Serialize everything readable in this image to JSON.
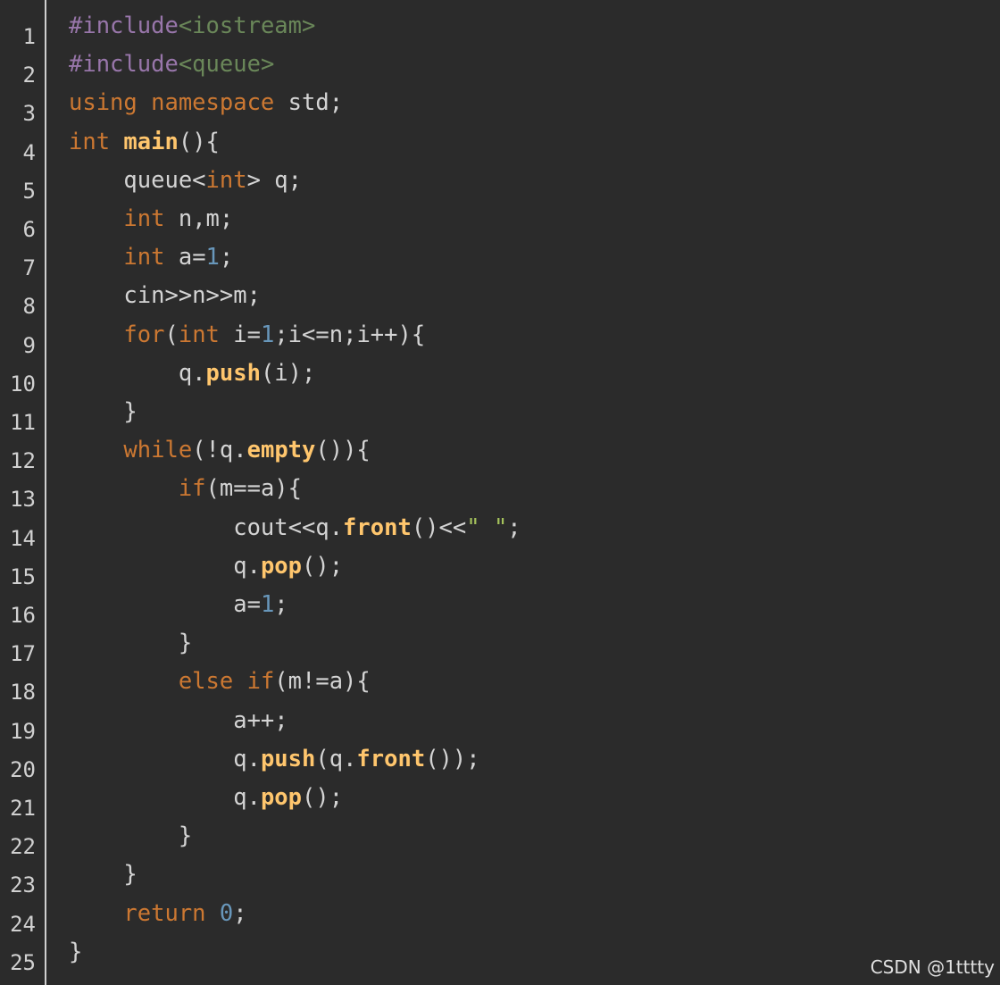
{
  "editor": {
    "lines": [
      {
        "no": "1",
        "tokens": [
          {
            "t": "#include",
            "c": "pp"
          },
          {
            "t": "<iostream>",
            "c": "inc"
          }
        ]
      },
      {
        "no": "2",
        "tokens": [
          {
            "t": "#include",
            "c": "pp"
          },
          {
            "t": "<queue>",
            "c": "inc"
          }
        ]
      },
      {
        "no": "3",
        "tokens": [
          {
            "t": "using namespace",
            "c": "kw"
          },
          {
            "t": " std;",
            "c": "plain"
          }
        ]
      },
      {
        "no": "4",
        "tokens": [
          {
            "t": "int",
            "c": "kw"
          },
          {
            "t": " ",
            "c": "plain"
          },
          {
            "t": "main",
            "c": "fn"
          },
          {
            "t": "(){",
            "c": "plain"
          }
        ]
      },
      {
        "no": "5",
        "tokens": [
          {
            "t": "    queue<",
            "c": "plain"
          },
          {
            "t": "int",
            "c": "kw"
          },
          {
            "t": "> q;",
            "c": "plain"
          }
        ]
      },
      {
        "no": "6",
        "tokens": [
          {
            "t": "    ",
            "c": "plain"
          },
          {
            "t": "int",
            "c": "kw"
          },
          {
            "t": " n,m;",
            "c": "plain"
          }
        ]
      },
      {
        "no": "7",
        "tokens": [
          {
            "t": "    ",
            "c": "plain"
          },
          {
            "t": "int",
            "c": "kw"
          },
          {
            "t": " a=",
            "c": "plain"
          },
          {
            "t": "1",
            "c": "num"
          },
          {
            "t": ";",
            "c": "plain"
          }
        ]
      },
      {
        "no": "8",
        "tokens": [
          {
            "t": "    cin>>n>>m;",
            "c": "plain"
          }
        ]
      },
      {
        "no": "9",
        "tokens": [
          {
            "t": "    ",
            "c": "plain"
          },
          {
            "t": "for",
            "c": "kw"
          },
          {
            "t": "(",
            "c": "plain"
          },
          {
            "t": "int",
            "c": "kw"
          },
          {
            "t": " i=",
            "c": "plain"
          },
          {
            "t": "1",
            "c": "num"
          },
          {
            "t": ";i<=n;i++){",
            "c": "plain"
          }
        ]
      },
      {
        "no": "10",
        "tokens": [
          {
            "t": "        q.",
            "c": "plain"
          },
          {
            "t": "push",
            "c": "fn"
          },
          {
            "t": "(i);",
            "c": "plain"
          }
        ]
      },
      {
        "no": "11",
        "tokens": [
          {
            "t": "    }",
            "c": "plain"
          }
        ]
      },
      {
        "no": "12",
        "tokens": [
          {
            "t": "    ",
            "c": "plain"
          },
          {
            "t": "while",
            "c": "kw"
          },
          {
            "t": "(!q.",
            "c": "plain"
          },
          {
            "t": "empty",
            "c": "fn"
          },
          {
            "t": "()){",
            "c": "plain"
          }
        ]
      },
      {
        "no": "13",
        "tokens": [
          {
            "t": "        ",
            "c": "plain"
          },
          {
            "t": "if",
            "c": "kw"
          },
          {
            "t": "(m==a){",
            "c": "plain"
          }
        ]
      },
      {
        "no": "14",
        "tokens": [
          {
            "t": "            cout<<q.",
            "c": "plain"
          },
          {
            "t": "front",
            "c": "fn"
          },
          {
            "t": "()<<",
            "c": "plain"
          },
          {
            "t": "\" \"",
            "c": "str"
          },
          {
            "t": ";",
            "c": "plain"
          }
        ]
      },
      {
        "no": "15",
        "tokens": [
          {
            "t": "            q.",
            "c": "plain"
          },
          {
            "t": "pop",
            "c": "fn"
          },
          {
            "t": "();",
            "c": "plain"
          }
        ]
      },
      {
        "no": "16",
        "tokens": [
          {
            "t": "            a=",
            "c": "plain"
          },
          {
            "t": "1",
            "c": "num"
          },
          {
            "t": ";",
            "c": "plain"
          }
        ]
      },
      {
        "no": "17",
        "tokens": [
          {
            "t": "        }",
            "c": "plain"
          }
        ]
      },
      {
        "no": "18",
        "tokens": [
          {
            "t": "        ",
            "c": "plain"
          },
          {
            "t": "else if",
            "c": "kw"
          },
          {
            "t": "(m!=a){",
            "c": "plain"
          }
        ]
      },
      {
        "no": "19",
        "tokens": [
          {
            "t": "            a++;",
            "c": "plain"
          }
        ]
      },
      {
        "no": "20",
        "tokens": [
          {
            "t": "            q.",
            "c": "plain"
          },
          {
            "t": "push",
            "c": "fn"
          },
          {
            "t": "(q.",
            "c": "plain"
          },
          {
            "t": "front",
            "c": "fn"
          },
          {
            "t": "());",
            "c": "plain"
          }
        ]
      },
      {
        "no": "21",
        "tokens": [
          {
            "t": "            q.",
            "c": "plain"
          },
          {
            "t": "pop",
            "c": "fn"
          },
          {
            "t": "();",
            "c": "plain"
          }
        ]
      },
      {
        "no": "22",
        "tokens": [
          {
            "t": "        }",
            "c": "plain"
          }
        ]
      },
      {
        "no": "23",
        "tokens": [
          {
            "t": "    }",
            "c": "plain"
          }
        ]
      },
      {
        "no": "24",
        "tokens": [
          {
            "t": "    ",
            "c": "plain"
          },
          {
            "t": "return",
            "c": "kw"
          },
          {
            "t": " ",
            "c": "plain"
          },
          {
            "t": "0",
            "c": "num"
          },
          {
            "t": ";",
            "c": "plain"
          }
        ]
      },
      {
        "no": "25",
        "tokens": [
          {
            "t": "}",
            "c": "plain"
          }
        ]
      }
    ]
  },
  "watermark": "CSDN @1tttty",
  "colors": {
    "background": "#2b2b2b",
    "keyword": "#cc7832",
    "preprocessor": "#9876aa",
    "include_path": "#6a8759",
    "function": "#ffc66d",
    "number": "#6897bb",
    "string": "#a5c25c",
    "plain": "#d4d4d4"
  }
}
